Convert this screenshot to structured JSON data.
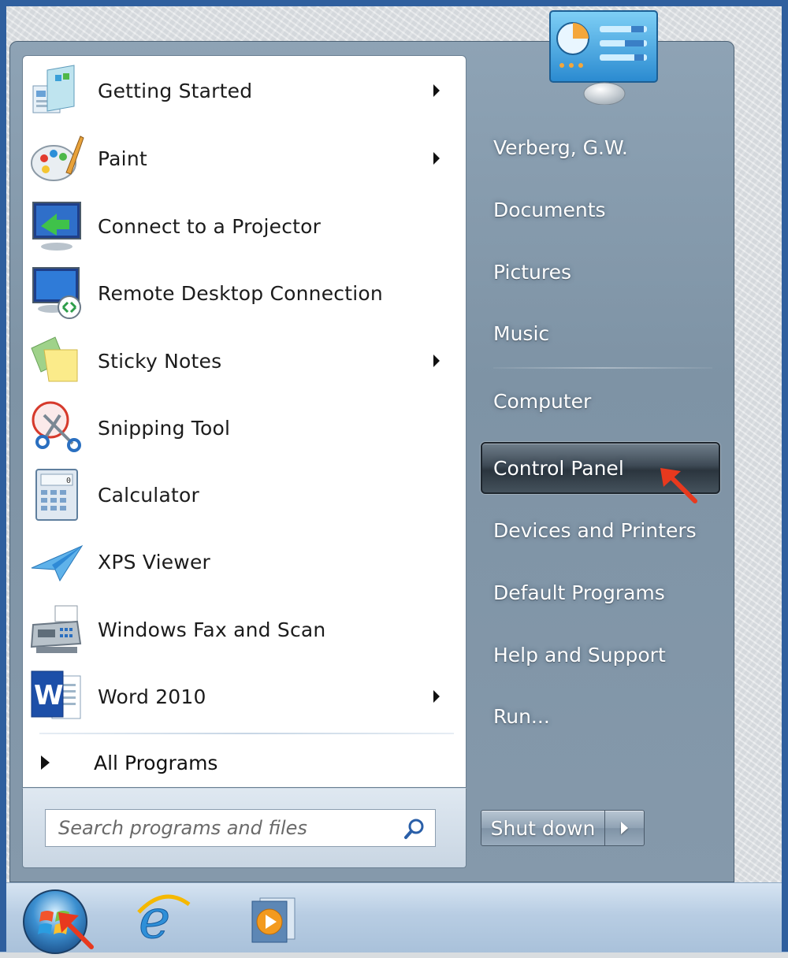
{
  "programs": [
    {
      "label": "Getting Started",
      "icon": "getting-started-icon",
      "submenu": true
    },
    {
      "label": "Paint",
      "icon": "paint-icon",
      "submenu": true
    },
    {
      "label": "Connect to a Projector",
      "icon": "projector-icon",
      "submenu": false
    },
    {
      "label": "Remote Desktop Connection",
      "icon": "remote-desktop-icon",
      "submenu": false
    },
    {
      "label": "Sticky Notes",
      "icon": "sticky-notes-icon",
      "submenu": true
    },
    {
      "label": "Snipping Tool",
      "icon": "snipping-tool-icon",
      "submenu": false
    },
    {
      "label": "Calculator",
      "icon": "calculator-icon",
      "submenu": false
    },
    {
      "label": "XPS Viewer",
      "icon": "xps-viewer-icon",
      "submenu": false
    },
    {
      "label": "Windows Fax and Scan",
      "icon": "fax-scan-icon",
      "submenu": false
    },
    {
      "label": "Word 2010",
      "icon": "word-icon",
      "submenu": true
    }
  ],
  "all_programs": {
    "label": "All Programs"
  },
  "search": {
    "placeholder": "Search programs and files",
    "value": ""
  },
  "right": {
    "user": "Verberg, G.W.",
    "documents": "Documents",
    "pictures": "Pictures",
    "music": "Music",
    "computer": "Computer",
    "control_panel": "Control Panel",
    "devices": "Devices and Printers",
    "default_programs": "Default Programs",
    "help": "Help and Support",
    "run": "Run..."
  },
  "shutdown": {
    "label": "Shut down"
  },
  "taskbar": {
    "items": [
      "start-orb-icon",
      "internet-explorer-icon",
      "media-player-icon"
    ]
  },
  "colors": {
    "frame": "#2f5f9e",
    "menu_glass": "#8599ab",
    "highlight": "#2b353e",
    "annotation_arrow": "#e8391e"
  },
  "annotations": [
    "red-arrow-control-panel",
    "red-arrow-start-orb"
  ]
}
